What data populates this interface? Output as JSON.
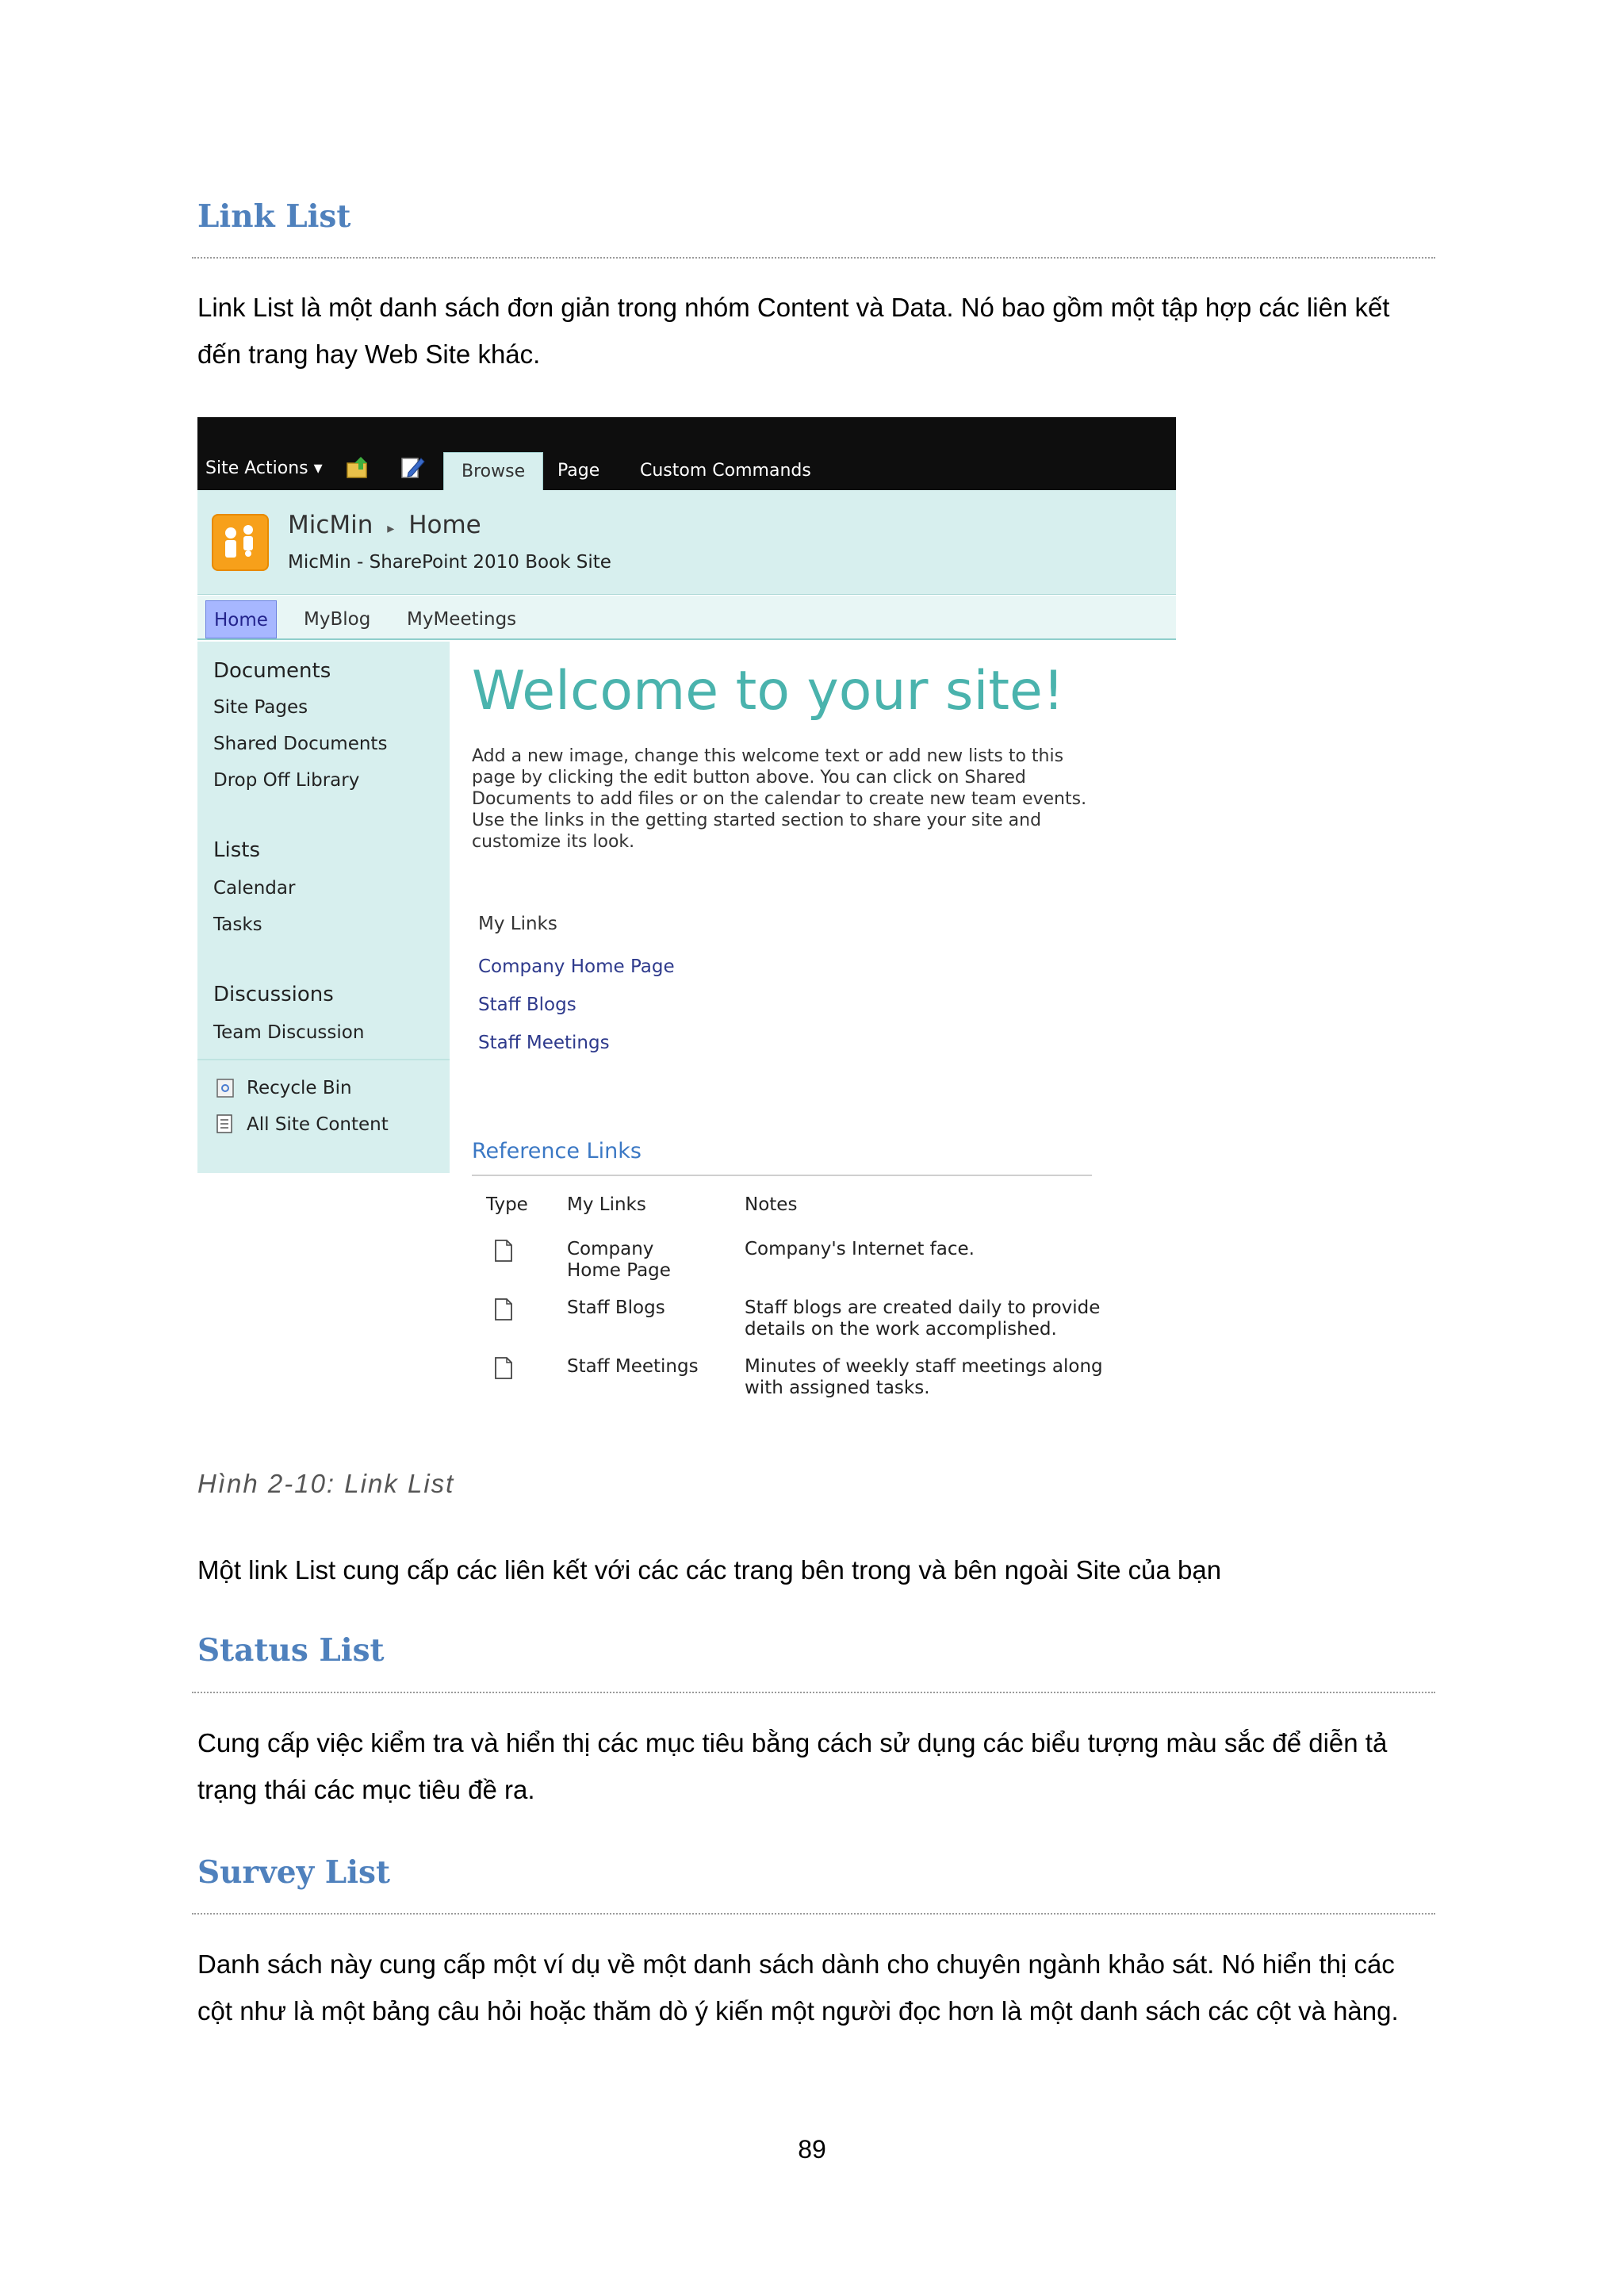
{
  "sections": {
    "link_list": {
      "heading": "Link List",
      "para": "Link List là một danh sách đơn giản trong nhóm Content và Data. Nó bao gồm một tập hợp các liên kết đến trang hay Web Site khác."
    },
    "caption": "Hình 2-10: Link List",
    "after_caption": "Một link List cung cấp các liên kết với các các trang bên trong và bên ngoài Site của bạn",
    "status_list": {
      "heading": "Status List",
      "para": "Cung cấp việc kiểm tra và hiển thị các mục tiêu bằng cách sử dụng các biểu tượng màu sắc để diễn tả trạng thái các mục tiêu đề ra."
    },
    "survey_list": {
      "heading": "Survey List",
      "para": "Danh sách này cung cấp một ví dụ về một danh sách dành cho chuyên ngành khảo sát. Nó hiển thị các cột như là một bảng câu hỏi hoặc thăm dò ý kiến một người đọc hơn là một danh sách các cột và hàng."
    },
    "page_number": "89"
  },
  "screenshot": {
    "ribbon": {
      "site_actions": "Site Actions ▾",
      "tabs": [
        "Browse",
        "Page",
        "Custom Commands"
      ]
    },
    "site": {
      "name": "MicMin",
      "separator": "▸",
      "page": "Home",
      "subtitle": "MicMin - SharePoint 2010 Book Site"
    },
    "topnav": [
      "Home",
      "MyBlog",
      "MyMeetings"
    ],
    "quicklaunch": {
      "documents": {
        "heading": "Documents",
        "items": [
          "Site Pages",
          "Shared Documents",
          "Drop Off Library"
        ]
      },
      "lists": {
        "heading": "Lists",
        "items": [
          "Calendar",
          "Tasks"
        ]
      },
      "discussions": {
        "heading": "Discussions",
        "items": [
          "Team Discussion"
        ]
      },
      "bottom": [
        "Recycle Bin",
        "All Site Content"
      ]
    },
    "welcome_title": "Welcome to your site!",
    "intro_lines": [
      "Add a new image, change this welcome text or add new lists to this",
      "page by clicking the edit button above. You can click on Shared",
      "Documents to add files or on the calendar to create new team events.",
      "Use the links in the getting started section to share your site and",
      "customize its look."
    ],
    "my_links": {
      "heading": "My Links",
      "items": [
        "Company Home Page",
        "Staff Blogs",
        "Staff Meetings"
      ]
    },
    "reference_links": {
      "heading": "Reference Links",
      "columns": [
        "Type",
        "My Links",
        "Notes"
      ],
      "rows": [
        {
          "link_lines": [
            "Company",
            "Home Page"
          ],
          "note_lines": [
            "Company's Internet face."
          ]
        },
        {
          "link_lines": [
            "Staff Blogs"
          ],
          "note_lines": [
            "Staff blogs are created daily to provide",
            "details on the work accomplished."
          ]
        },
        {
          "link_lines": [
            "Staff Meetings"
          ],
          "note_lines": [
            "Minutes of weekly staff meetings along",
            "with assigned tasks."
          ]
        }
      ]
    },
    "colors": {
      "accent": "#4f81bd",
      "sp_teal": "#d7efee",
      "welcome": "#4ab3ad",
      "link": "#2e3a8c"
    }
  }
}
